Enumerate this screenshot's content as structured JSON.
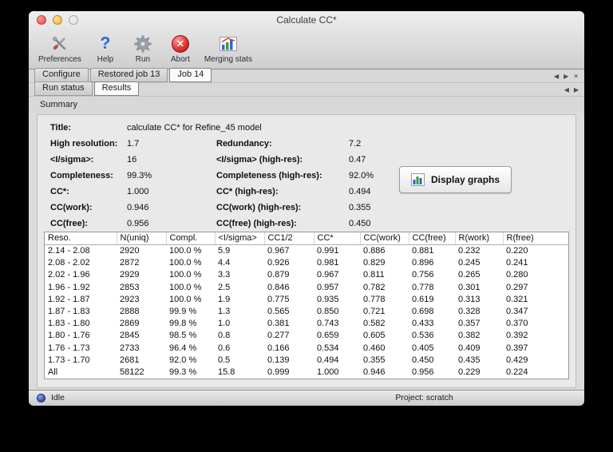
{
  "window": {
    "title": "Calculate CC*",
    "controls": [
      "close-button",
      "minimize-button",
      "zoom-button"
    ]
  },
  "toolbar": {
    "items": [
      {
        "label": "Preferences",
        "icon": "preferences-icon"
      },
      {
        "label": "Help",
        "icon": "help-icon"
      },
      {
        "label": "Run",
        "icon": "run-icon"
      },
      {
        "label": "Abort",
        "icon": "abort-icon"
      },
      {
        "label": "Merging stats",
        "icon": "merging-stats-icon"
      }
    ]
  },
  "job_tabs": {
    "tabs": [
      {
        "label": "Configure",
        "active": false
      },
      {
        "label": "Restored job 13",
        "active": false
      },
      {
        "label": "Job 14",
        "active": true
      }
    ],
    "nav_icons": [
      "tab-scroll-left-icon",
      "tab-scroll-right-icon",
      "tab-close-icon"
    ]
  },
  "result_tabs": {
    "tabs": [
      {
        "label": "Run status",
        "active": false
      },
      {
        "label": "Results",
        "active": true
      }
    ],
    "nav_icons": [
      "tab-scroll-left-icon",
      "tab-scroll-right-icon"
    ]
  },
  "section": {
    "label": "Summary"
  },
  "summary": {
    "rows": [
      {
        "l1": "Title:",
        "v1": "calculate CC* for Refine_45 model",
        "l2": "",
        "v2": ""
      },
      {
        "l1": "High resolution:",
        "v1": "1.7",
        "l2": "Redundancy:",
        "v2": "7.2"
      },
      {
        "l1": "<I/sigma>:",
        "v1": "16",
        "l2": "<I/sigma> (high-res):",
        "v2": "0.47"
      },
      {
        "l1": "Completeness:",
        "v1": "99.3%",
        "l2": "Completeness (high-res):",
        "v2": "92.0%"
      },
      {
        "l1": "CC*:",
        "v1": "1.000",
        "l2": "CC* (high-res):",
        "v2": "0.494"
      },
      {
        "l1": "CC(work):",
        "v1": "0.946",
        "l2": "CC(work) (high-res):",
        "v2": "0.355"
      },
      {
        "l1": "CC(free):",
        "v1": "0.956",
        "l2": "CC(free) (high-res):",
        "v2": "0.450"
      }
    ],
    "display_graphs": {
      "label": "Display graphs",
      "icon": "bar-chart-icon"
    }
  },
  "table": {
    "columns": [
      "Reso.",
      "N(uniq)",
      "Compl.",
      "<I/sigma>",
      "CC1/2",
      "CC*",
      "CC(work)",
      "CC(free)",
      "R(work)",
      "R(free)"
    ],
    "rows": [
      [
        "2.14 - 2.08",
        "2920",
        "100.0 %",
        "5.9",
        "0.967",
        "0.991",
        "0.886",
        "0.881",
        "0.232",
        "0.220"
      ],
      [
        "2.08 - 2.02",
        "2872",
        "100.0 %",
        "4.4",
        "0.926",
        "0.981",
        "0.829",
        "0.896",
        "0.245",
        "0.241"
      ],
      [
        "2.02 - 1.96",
        "2929",
        "100.0 %",
        "3.3",
        "0.879",
        "0.967",
        "0.811",
        "0.756",
        "0.265",
        "0.280"
      ],
      [
        "1.96 - 1.92",
        "2853",
        "100.0 %",
        "2.5",
        "0.846",
        "0.957",
        "0.782",
        "0.778",
        "0.301",
        "0.297"
      ],
      [
        "1.92 - 1.87",
        "2923",
        "100.0 %",
        "1.9",
        "0.775",
        "0.935",
        "0.778",
        "0.619",
        "0.313",
        "0.321"
      ],
      [
        "1.87 - 1.83",
        "2888",
        "99.9 %",
        "1.3",
        "0.565",
        "0.850",
        "0.721",
        "0.698",
        "0.328",
        "0.347"
      ],
      [
        "1.83 - 1.80",
        "2869",
        "99.8 %",
        "1.0",
        "0.381",
        "0.743",
        "0.582",
        "0.433",
        "0.357",
        "0.370"
      ],
      [
        "1.80 - 1.76",
        "2845",
        "98.5 %",
        "0.8",
        "0.277",
        "0.659",
        "0.605",
        "0.536",
        "0.382",
        "0.392"
      ],
      [
        "1.76 - 1.73",
        "2733",
        "96.4 %",
        "0.6",
        "0.166",
        "0.534",
        "0.460",
        "0.405",
        "0.409",
        "0.397"
      ],
      [
        "1.73 - 1.70",
        "2681",
        "92.0 %",
        "0.5",
        "0.139",
        "0.494",
        "0.355",
        "0.450",
        "0.435",
        "0.429"
      ],
      [
        "All",
        "58122",
        "99.3 %",
        "15.8",
        "0.999",
        "1.000",
        "0.946",
        "0.956",
        "0.229",
        "0.224"
      ]
    ]
  },
  "status_bar": {
    "indicator_icon": "status-indicator-dot",
    "status": "Idle",
    "project": "Project: scratch"
  },
  "colors": {
    "status_dot": "#2b3f9e",
    "close_light": "#fc5753",
    "minimize_light": "#fdbc40",
    "zoom_light": "#33c748",
    "help_blue": "#2e6bd8",
    "abort_red": "#e03030"
  }
}
